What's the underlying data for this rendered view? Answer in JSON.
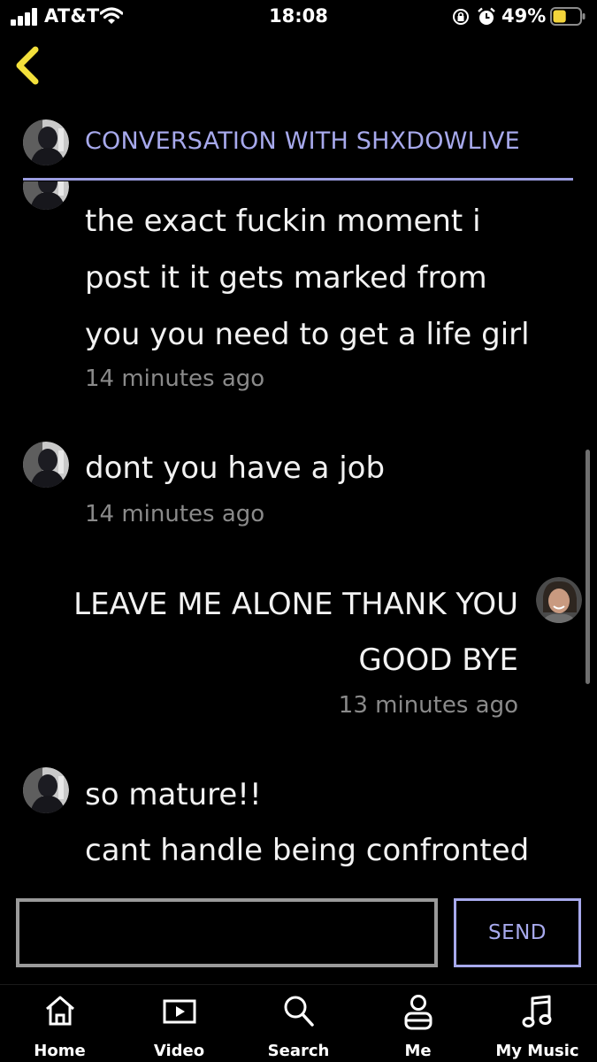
{
  "status_bar": {
    "carrier": "AT&T",
    "time": "18:08",
    "battery_percent": "49%",
    "battery_level": 0.49,
    "icons": [
      "signal-icon",
      "wifi-icon",
      "orientation-lock-icon",
      "alarm-icon",
      "battery-icon"
    ]
  },
  "header": {
    "back_icon": "chevron-left-icon",
    "title": "CONVERSATION WITH SHXDOWLIVE"
  },
  "colors": {
    "accent": "#a7a9ec",
    "back_arrow": "#f3e03b",
    "background": "#000000",
    "timestamp": "#8a8a8a"
  },
  "messages": [
    {
      "sender": "other",
      "lines": [
        "the exact fuckin moment i",
        "post it it gets marked from",
        "you you need to get a life girl"
      ],
      "time": "14 minutes ago"
    },
    {
      "sender": "other",
      "lines": [
        "dont you have a job"
      ],
      "time": "14 minutes ago"
    },
    {
      "sender": "me",
      "lines": [
        "LEAVE ME ALONE THANK YOU",
        "GOOD BYE"
      ],
      "time": "13 minutes ago"
    },
    {
      "sender": "other",
      "lines": [
        "so mature!!",
        "cant handle being confronted"
      ],
      "time": ""
    }
  ],
  "composer": {
    "input_value": "",
    "send_label": "SEND"
  },
  "tabs": [
    {
      "label": "Home",
      "icon": "home-icon"
    },
    {
      "label": "Video",
      "icon": "video-icon"
    },
    {
      "label": "Search",
      "icon": "search-icon"
    },
    {
      "label": "Me",
      "icon": "profile-icon"
    },
    {
      "label": "My Music",
      "icon": "music-note-icon"
    }
  ]
}
